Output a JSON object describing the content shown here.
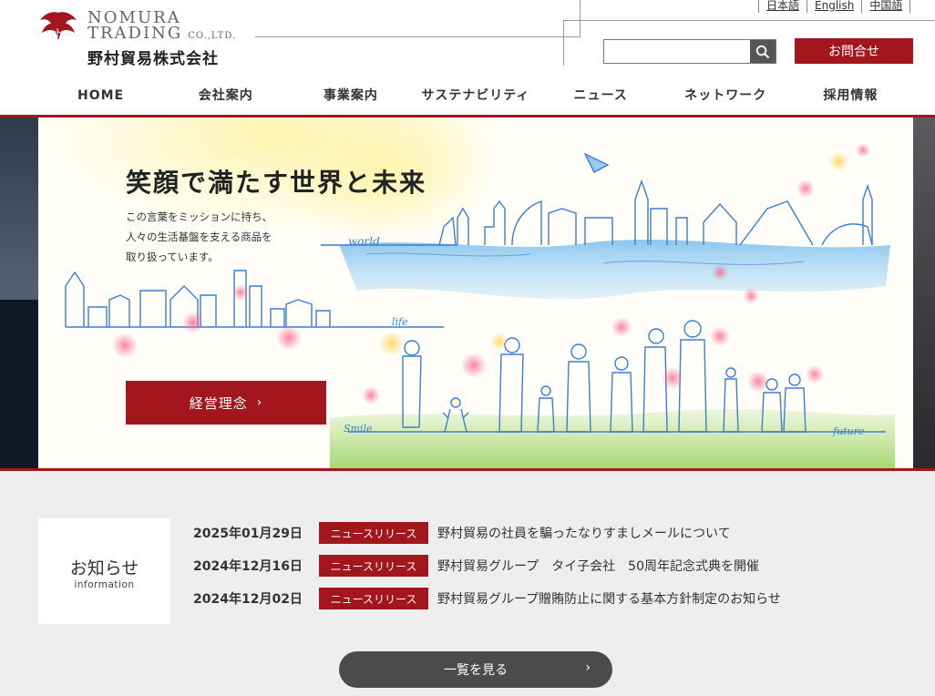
{
  "logo": {
    "name_en_1": "NOMURA",
    "name_en_2": "TRADING",
    "name_en_suffix": "CO.,LTD.",
    "name_ja": "野村貿易株式会社"
  },
  "languages": [
    "日本語",
    "English",
    "中国語"
  ],
  "search": {
    "placeholder": "",
    "value": "",
    "icon": "search-icon"
  },
  "contact_label": "お問合せ",
  "nav": [
    "HOME",
    "会社案内",
    "事業案内",
    "サステナビリティ",
    "ニュース",
    "ネットワーク",
    "採用情報"
  ],
  "hero": {
    "title": "笑顔で満たす世界と未来",
    "text_lines": [
      "この言葉をミッションに持ち、",
      "人々の生活基盤を支える商品を",
      "取り扱っています。"
    ],
    "button_label": "経営理念",
    "button_icon": "chevron-right-icon",
    "illustration_words": [
      "world",
      "life",
      "Smile",
      "future"
    ]
  },
  "news": {
    "heading": "お知らせ",
    "subheading": "information",
    "items": [
      {
        "date": "2025年01月29日",
        "category": "ニュースリリース",
        "title": "野村貿易の社員を騙ったなりすましメールについて"
      },
      {
        "date": "2024年12月16日",
        "category": "ニュースリリース",
        "title": "野村貿易グループ　タイ子会社　50周年記念式典を開催"
      },
      {
        "date": "2024年12月02日",
        "category": "ニュースリリース",
        "title": "野村貿易グループ贈賄防止に関する基本方針制定のお知らせ"
      }
    ],
    "more_label": "一覧を見る",
    "more_icon": "chevron-right-icon"
  },
  "colors": {
    "brand_red": "#a3161d",
    "dark_button": "#4b4b4b",
    "news_bg": "#eeeeee",
    "sketch_blue": "#3b7fd0"
  }
}
